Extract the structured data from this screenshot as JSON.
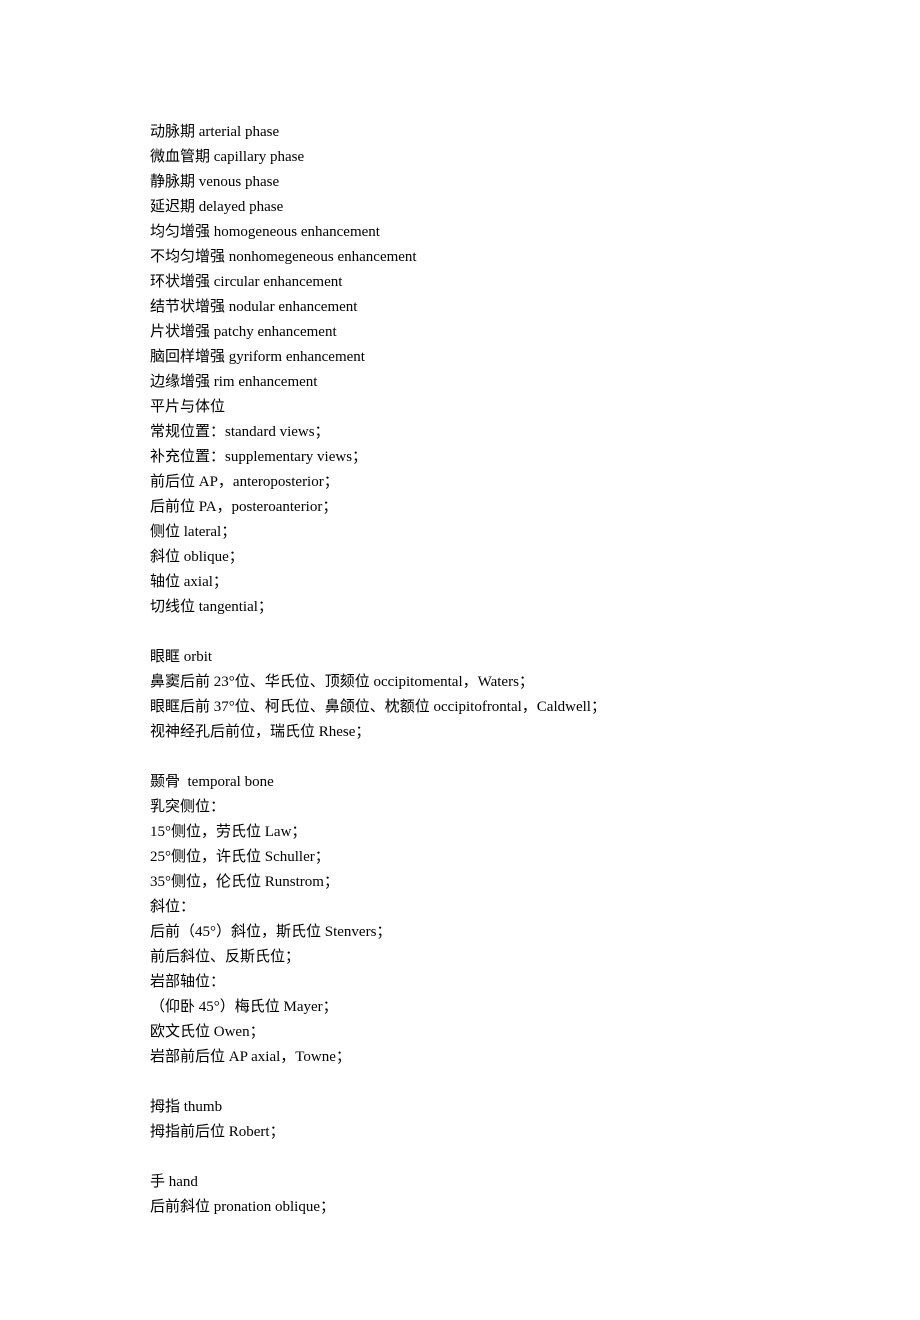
{
  "s1": [
    "动脉期 arterial phase",
    "微血管期 capillary phase",
    "静脉期 venous phase",
    "延迟期 delayed phase",
    "均匀增强 homogeneous enhancement",
    "不均匀增强 nonhomegeneous enhancement",
    "环状增强 circular enhancement",
    "结节状增强 nodular enhancement",
    "片状增强 patchy enhancement",
    "脑回样增强 gyriform enhancement",
    "边缘增强 rim enhancement",
    "平片与体位",
    "常规位置：standard views；",
    "补充位置：supplementary views；",
    "前后位 AP，anteroposterior；",
    "后前位 PA，posteroanterior；",
    "侧位 lateral；",
    "斜位 oblique；",
    "轴位 axial；",
    "切线位 tangential；"
  ],
  "s2": [
    "眼眶 orbit",
    "鼻窦后前 23°位、华氏位、顶颏位 occipitomental，Waters；",
    "眼眶后前 37°位、柯氏位、鼻颌位、枕额位 occipitofrontal，Caldwell；",
    "视神经孔后前位，瑞氏位 Rhese；"
  ],
  "s3": [
    "颞骨  temporal bone",
    "乳突侧位：",
    "15°侧位，劳氏位 Law；",
    "25°侧位，许氏位 Schuller；",
    "35°侧位，伦氏位 Runstrom；",
    "斜位：",
    "后前（45°）斜位，斯氏位 Stenvers；",
    "前后斜位、反斯氏位；",
    "岩部轴位：",
    "（仰卧 45°）梅氏位 Mayer；",
    "欧文氏位 Owen；",
    "岩部前后位 AP axial，Towne；"
  ],
  "s4": [
    "拇指 thumb",
    "拇指前后位 Robert；"
  ],
  "s5": [
    "手 hand",
    "后前斜位 pronation oblique；"
  ]
}
